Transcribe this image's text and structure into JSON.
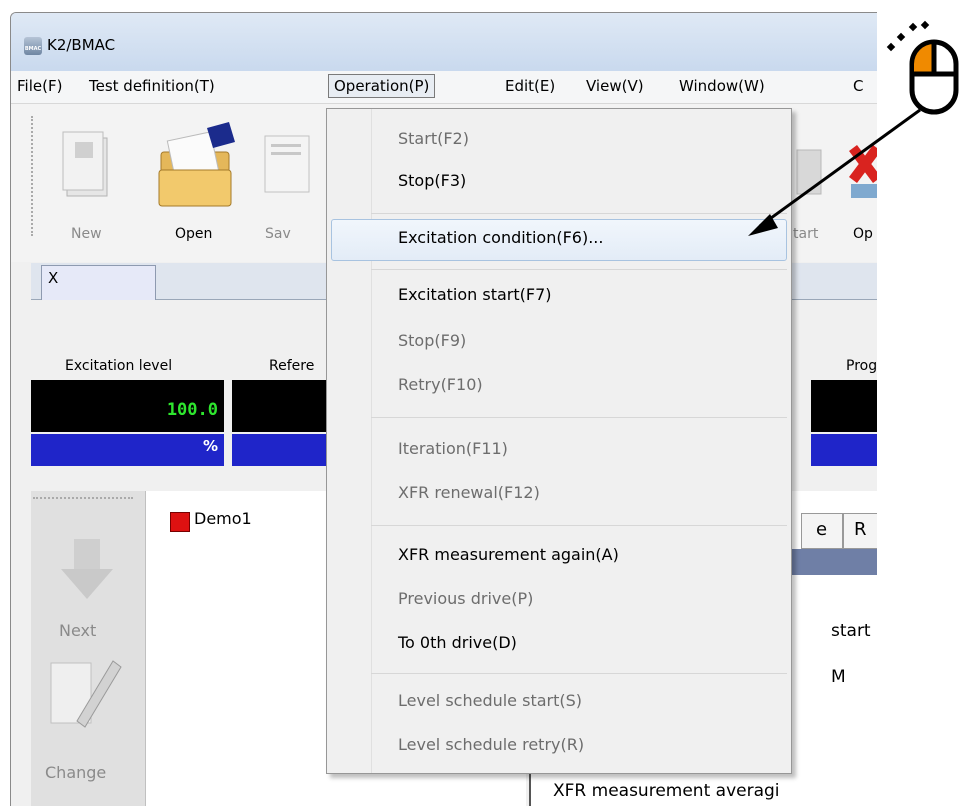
{
  "window": {
    "title": "K2/BMAC",
    "icon_text": "BMAC"
  },
  "menubar": {
    "items": [
      "File(F)",
      "Test definition(T)",
      "Operation(P)",
      "Edit(E)",
      "View(V)",
      "Window(W)",
      "C"
    ],
    "open_index": 2
  },
  "toolbar": {
    "buttons": [
      {
        "label": "New",
        "enabled": false
      },
      {
        "label": "Open",
        "enabled": true
      },
      {
        "label": "Sav",
        "enabled": false
      },
      {
        "label": "tart",
        "enabled": false
      },
      {
        "label": "Op",
        "enabled": true
      }
    ]
  },
  "tabs": [
    {
      "label": "X"
    }
  ],
  "monitor": {
    "labels": [
      "Excitation level",
      "Refere",
      "Prog"
    ],
    "excitation_value": "100.0",
    "excitation_unit": "%"
  },
  "left_panel": {
    "buttons": [
      "Next",
      "Change"
    ]
  },
  "tree": {
    "root": "Demo1"
  },
  "right_pane": {
    "tabs": [
      "e",
      "R"
    ],
    "lines": [
      "start",
      "M",
      "XFR measurement averagi"
    ]
  },
  "operation_menu": {
    "items": [
      {
        "label": "Start(F2)",
        "enabled": false
      },
      {
        "label": "Stop(F3)",
        "enabled": true
      },
      {
        "label": "Excitation condition(F6)...",
        "enabled": true,
        "highlighted": true
      },
      {
        "label": "Excitation start(F7)",
        "enabled": true
      },
      {
        "label": "Stop(F9)",
        "enabled": false
      },
      {
        "label": "Retry(F10)",
        "enabled": false
      },
      {
        "label": "Iteration(F11)",
        "enabled": false
      },
      {
        "label": "XFR renewal(F12)",
        "enabled": false
      },
      {
        "label": "XFR measurement again(A)",
        "enabled": true
      },
      {
        "label": "Previous drive(P)",
        "enabled": false
      },
      {
        "label": "To 0th drive(D)",
        "enabled": true
      },
      {
        "label": "Level schedule start(S)",
        "enabled": false
      },
      {
        "label": "Level schedule retry(R)",
        "enabled": false
      }
    ]
  },
  "annotation": {
    "icon": "mouse-click-icon",
    "accent": "#f08a00"
  },
  "colors": {
    "value_text": "#2ee62e",
    "value_bg": "#000000",
    "unit_bg": "#1f25c9"
  }
}
